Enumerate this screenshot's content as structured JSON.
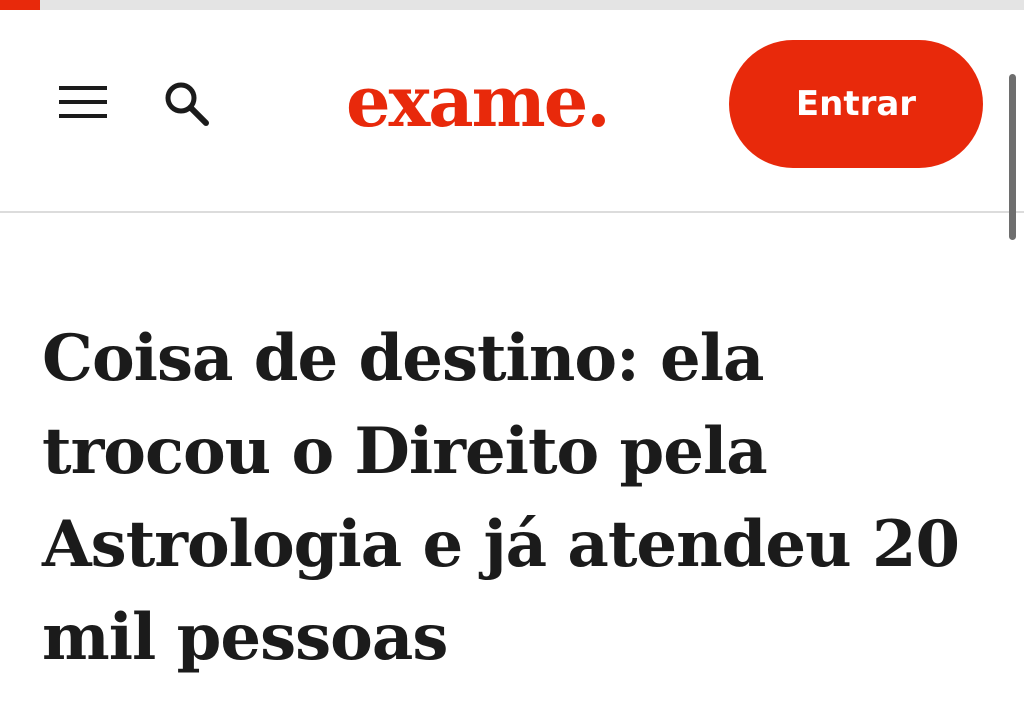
{
  "progress": {
    "fraction": 0.039,
    "color": "#e8290b"
  },
  "header": {
    "menu_icon": "hamburger-menu-icon",
    "search_icon": "search-icon",
    "logo_text": "exame.",
    "login_label": "Entrar",
    "accent_color": "#e8290b"
  },
  "article": {
    "headline": "Coisa de destino: ela trocou o Direito pela Astrologia e já atendeu 20 mil pessoas"
  }
}
